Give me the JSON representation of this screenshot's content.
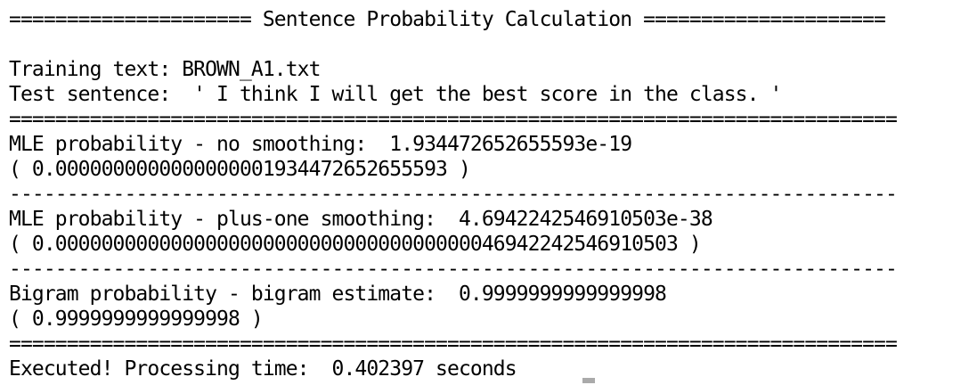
{
  "header": "===================== Sentence Probability Calculation =====================",
  "training_line": "Training text: BROWN_A1.txt",
  "test_line": "Test sentence:  ' I think I will get the best score in the class. '",
  "separator_double": "=============================================================================",
  "separator_single": "-----------------------------------------------------------------------------",
  "mle_no_smoothing": {
    "label": "MLE probability - no smoothing:  1.934472652655593e-19",
    "decimal": "( 0.0000000000000000001934472652655593 )"
  },
  "mle_plus_one": {
    "label": "MLE probability - plus-one smoothing:  4.6942242546910503e-38",
    "decimal": "( 0.000000000000000000000000000000000000046942242546910503 )"
  },
  "bigram": {
    "label": "Bigram probability - bigram estimate:  0.9999999999999998",
    "decimal": "( 0.9999999999999998 )"
  },
  "footer": "Executed! Processing time:  0.402397 seconds"
}
